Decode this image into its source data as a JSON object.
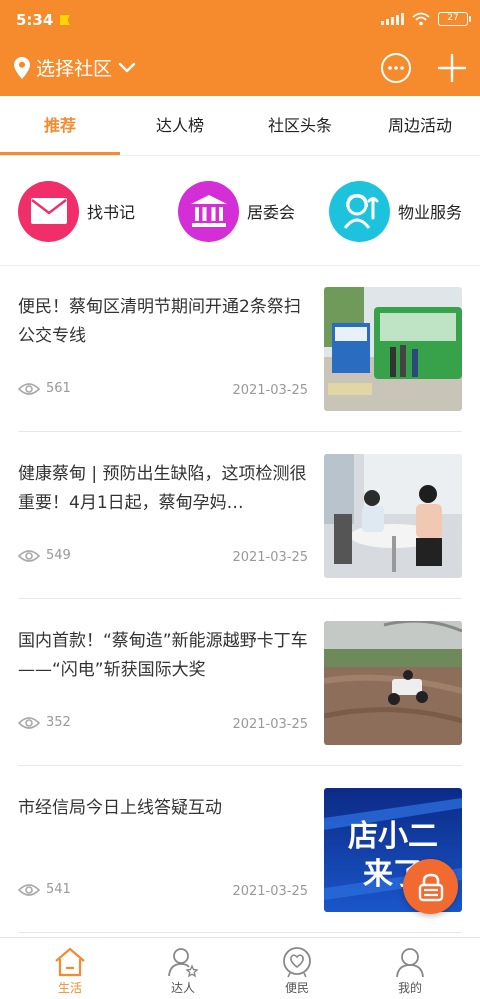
{
  "status": {
    "time": "5:34",
    "battery": "27"
  },
  "header": {
    "location_label": "选择社区"
  },
  "tabs": [
    {
      "label": "推荐",
      "active": true
    },
    {
      "label": "达人榜",
      "active": false
    },
    {
      "label": "社区头条",
      "active": false
    },
    {
      "label": "周边活动",
      "active": false
    }
  ],
  "quick_actions": [
    {
      "label": "找书记",
      "icon": "mail-icon",
      "color": "#f02e6a"
    },
    {
      "label": "居委会",
      "icon": "bank-icon",
      "color": "#d42fd7"
    },
    {
      "label": "物业服务",
      "icon": "service-agent-icon",
      "color": "#1dc3dd"
    }
  ],
  "news": [
    {
      "title": "便民！蔡甸区清明节期间开通2条祭扫公交专线",
      "views": "561",
      "date": "2021-03-25",
      "image": "bus-stop-photo"
    },
    {
      "title": "健康蔡甸 | 预防出生缺陷，这项检测很重要！4月1日起，蔡甸孕妈…",
      "views": "549",
      "date": "2021-03-25",
      "image": "clinic-photo"
    },
    {
      "title": "国内首款！“蔡甸造”新能源越野卡丁车——“闪电”斩获国际大奖",
      "views": "352",
      "date": "2021-03-25",
      "image": "kart-photo"
    },
    {
      "title": "市经信局今日上线答疑互动",
      "views": "541",
      "date": "2021-03-25",
      "image": "banner-graphic"
    }
  ],
  "thumb_banner_text": {
    "line1": "店小二",
    "line2": "来了"
  },
  "bottom_nav": [
    {
      "label": "生活",
      "icon": "home-icon",
      "active": true
    },
    {
      "label": "达人",
      "icon": "person-star-icon",
      "active": false
    },
    {
      "label": "便民",
      "icon": "heart-badge-icon",
      "active": false
    },
    {
      "label": "我的",
      "icon": "user-icon",
      "active": false
    }
  ],
  "colors": {
    "brand": "#f58b2c",
    "fab": "#f26a30",
    "text": "#333333",
    "meta": "#999999"
  }
}
